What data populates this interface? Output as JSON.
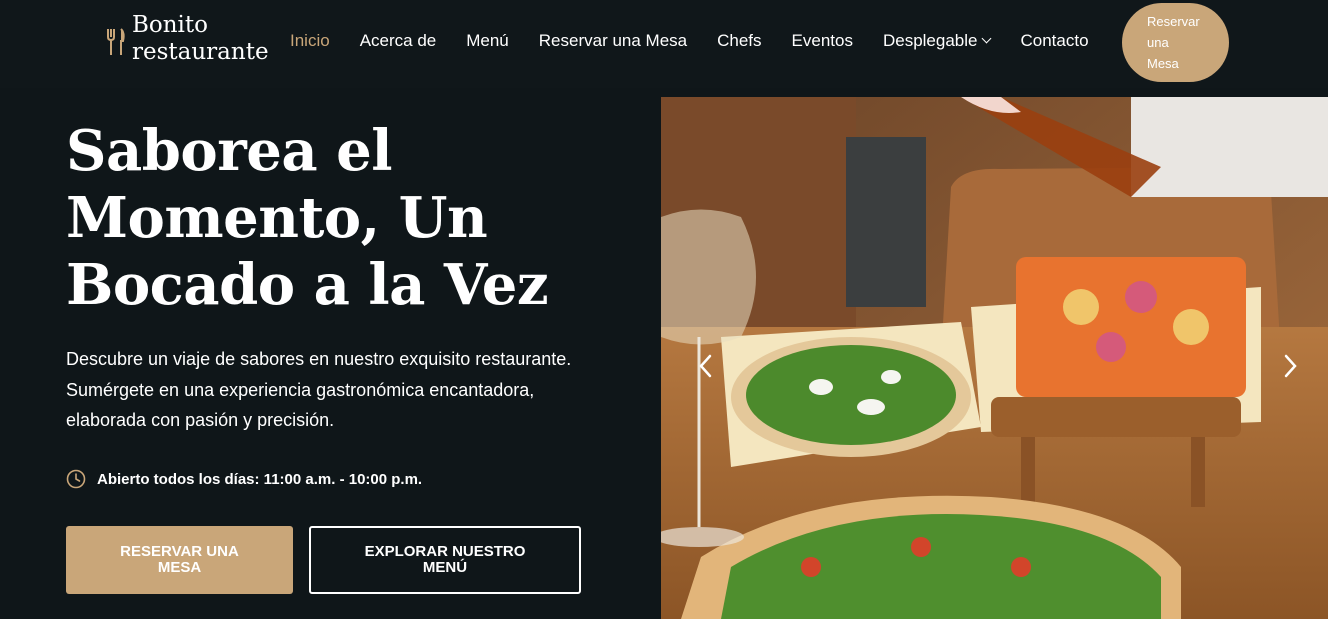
{
  "header": {
    "logo_line1": "Bonito",
    "logo_line2": "restaurante",
    "logo_icon": "fork-knife-icon",
    "nav": [
      {
        "label": "Inicio",
        "active": true
      },
      {
        "label": "Acerca de"
      },
      {
        "label": "Menú"
      },
      {
        "label": "Reservar una Mesa"
      },
      {
        "label": "Chefs"
      },
      {
        "label": "Eventos"
      },
      {
        "label": "Desplegable"
      },
      {
        "label": "Contacto"
      }
    ],
    "cta_lines": [
      "Reservar",
      "una",
      "Mesa"
    ]
  },
  "hero": {
    "title_lines": [
      "Saborea el",
      "Momento, Un",
      "Bocado a la Vez"
    ],
    "description_lines": [
      "Descubre un viaje de sabores en nuestro exquisito restaurante.",
      "Sumérgete en una experiencia gastronómica encantadora,",
      "elaborada con pasión y precisión."
    ],
    "hours": "Abierto todos los días: 11:00 a.m. - 10:00 p.m.",
    "primary_button": "Reservar una Mesa",
    "secondary_button": "Explorar Nuestro Menú"
  },
  "slider": {
    "image": "food-photo",
    "prev_icon": "chevron-left-icon",
    "next_icon": "chevron-right-icon"
  },
  "colors": {
    "background": "#0f1619",
    "accent": "#c9a679",
    "text": "#ffffff"
  }
}
